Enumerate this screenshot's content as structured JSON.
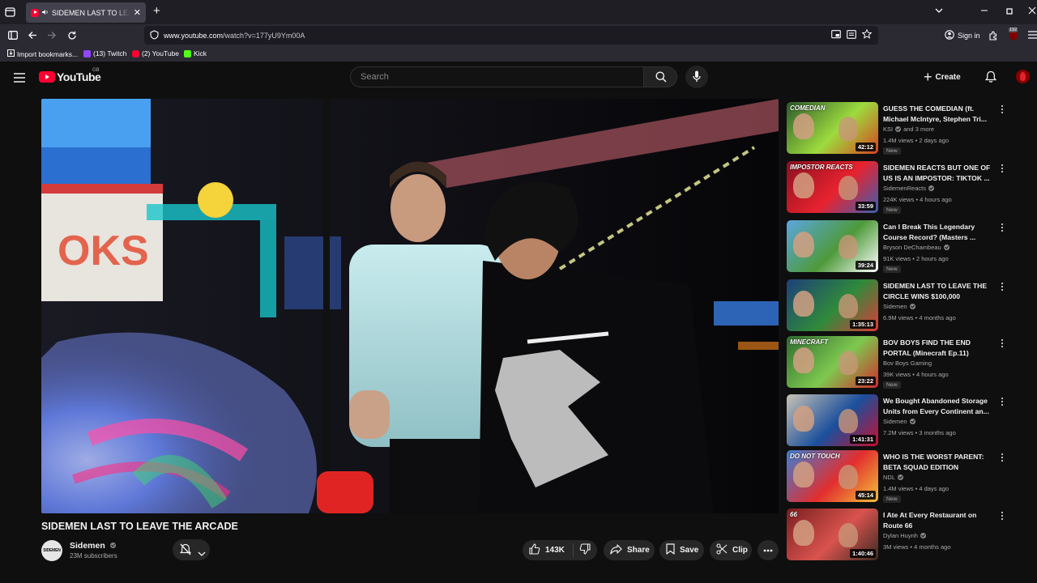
{
  "browser": {
    "tab_title": "SIDEMEN LAST TO LEAVE THE ARCADE",
    "url_host": "www.youtube.com",
    "url_path": "/watch?v=177yU9Ym00A",
    "sign_in": "Sign in",
    "ext_badge": "192",
    "bookmarks": [
      {
        "label": "Import bookmarks...",
        "icon": "import-icon",
        "color": "#fbfbfe"
      },
      {
        "label": "(13) Twitch",
        "icon": "twitch-icon",
        "color": "#9146ff"
      },
      {
        "label": "(2) YouTube",
        "icon": "youtube-icon",
        "color": "#ff0033"
      },
      {
        "label": "Kick",
        "icon": "kick-icon",
        "color": "#53fc18"
      }
    ]
  },
  "header": {
    "logo_text": "YouTube",
    "country_code": "GB",
    "search_placeholder": "Search",
    "create_label": "Create"
  },
  "video": {
    "title": "SIDEMEN LAST TO LEAVE THE ARCADE",
    "channel": "Sidemen",
    "channel_avatar_text": "SIDEMEN",
    "subscribers": "23M subscribers",
    "likes": "143K",
    "share": "Share",
    "save": "Save",
    "clip": "Clip"
  },
  "related": [
    {
      "title": "GUESS THE COMEDIAN (ft. Michael McIntyre, Stephen Tri...",
      "channel": "KSI",
      "channel_extra": "and 3 more",
      "verified": true,
      "views": "1.4M views",
      "age": "2 days ago",
      "badge": "New",
      "duration": "42:12",
      "thumb_colors": [
        "#2c5a2b",
        "#9ddb3e",
        "#d9421e"
      ],
      "thumb_text": "COMEDIAN"
    },
    {
      "title": "SIDEMEN REACTS BUT ONE OF US IS AN IMPOSTOR: TIKTOK ...",
      "channel": "SidemenReacts",
      "channel_extra": "",
      "verified": true,
      "views": "224K views",
      "age": "4 hours ago",
      "badge": "New",
      "duration": "33:59",
      "thumb_colors": [
        "#8a1020",
        "#e8222f",
        "#3b5fb0"
      ],
      "thumb_text": "IMPOSTOR REACTS"
    },
    {
      "title": "Can I Break This Legendary Course Record? (Masters ...",
      "channel": "Bryson DeChambeau",
      "channel_extra": "",
      "verified": true,
      "views": "91K views",
      "age": "2 hours ago",
      "badge": "New",
      "duration": "39:24",
      "thumb_colors": [
        "#5aa6e0",
        "#4e9a3a",
        "#ffffff"
      ],
      "thumb_text": ""
    },
    {
      "title": "SIDEMEN LAST TO LEAVE THE CIRCLE WINS $100,000",
      "channel": "Sidemen",
      "channel_extra": "",
      "verified": true,
      "views": "6.9M views",
      "age": "4 months ago",
      "badge": "",
      "duration": "1:35:13",
      "thumb_colors": [
        "#1d3f7a",
        "#2f8a3a",
        "#e03a3a"
      ],
      "thumb_text": ""
    },
    {
      "title": "BOV BOYS FIND THE END PORTAL (Minecraft Ep.11)",
      "channel": "Bov Boys Gaming",
      "channel_extra": "",
      "verified": false,
      "views": "39K views",
      "age": "4 hours ago",
      "badge": "New",
      "duration": "23:22",
      "thumb_colors": [
        "#2e6b2e",
        "#7ec850",
        "#d22b2b"
      ],
      "thumb_text": "MINECRAFT"
    },
    {
      "title": "We Bought Abandoned Storage Units from Every Continent an...",
      "channel": "Sidemen",
      "channel_extra": "",
      "verified": true,
      "views": "7.2M views",
      "age": "3 months ago",
      "badge": "",
      "duration": "1:41:31",
      "thumb_colors": [
        "#c9c3b6",
        "#1b4f9c",
        "#c8102e"
      ],
      "thumb_text": ""
    },
    {
      "title": "WHO IS THE WORST PARENT: BETA SQUAD EDITION",
      "channel": "NDL",
      "channel_extra": "",
      "verified": true,
      "views": "1.4M views",
      "age": "4 days ago",
      "badge": "New",
      "duration": "45:14",
      "thumb_colors": [
        "#3d7fd6",
        "#e22e2e",
        "#f3c23a"
      ],
      "thumb_text": "DO NOT TOUCH"
    },
    {
      "title": "I Ate At Every Restaurant on Route 66",
      "channel": "Dylan Huynh",
      "channel_extra": "",
      "verified": true,
      "views": "3M views",
      "age": "4 months ago",
      "badge": "",
      "duration": "1:40:46",
      "thumb_colors": [
        "#7a1e1e",
        "#d9534f",
        "#3a2a20"
      ],
      "thumb_text": "66"
    }
  ]
}
